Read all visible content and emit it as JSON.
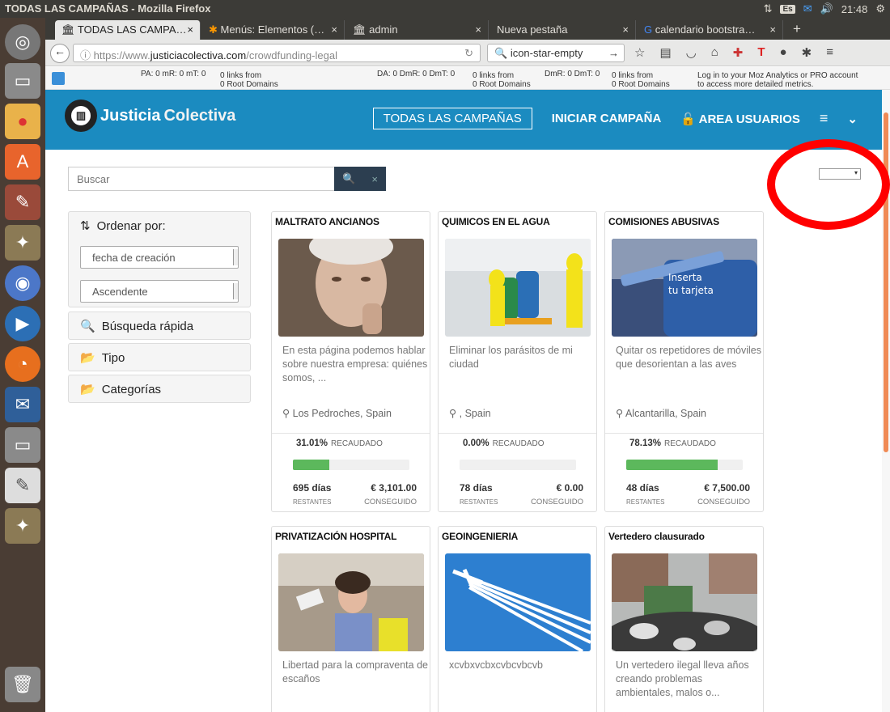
{
  "os": {
    "window_title": "TODAS LAS CAMPAÑAS - Mozilla Firefox",
    "kb": "Es",
    "clock": "21:48"
  },
  "browser": {
    "tabs": [
      {
        "label": "TODAS LAS CAMPA…"
      },
      {
        "label": "Menús: Elementos (…"
      },
      {
        "label": "admin"
      },
      {
        "label": "Nueva pestaña"
      },
      {
        "label": "calendario bootstra…"
      }
    ],
    "new_tab": "+",
    "url_prefix": "https://www.",
    "url_host": "justiciacolectiva.com",
    "url_path": "/crowdfunding-legal",
    "search_value": "icon-star-empty"
  },
  "moz": {
    "pa": "PA: 0   mR: 0   mT: 0",
    "links1a": "0 links from",
    "links1b": "0 Root Domains",
    "da": "DA: 0  DmR: 0  DmT: 0",
    "links2a": "0 links from",
    "links2b": "0 Root Domains",
    "dmr": "DmR: 0  DmT: 0",
    "links3a": "0 links from",
    "links3b": "0 Root Domains",
    "login_a": "Log in to your Moz Analytics or PRO account",
    "login_b": "to access more detailed metrics."
  },
  "site": {
    "logo_a": "Justicia",
    "logo_b": "Colectiva",
    "nav": {
      "all": "TODAS LAS CAMPAÑAS",
      "start": "INICIAR CAMPAÑA",
      "users": "AREA USUARIOS"
    }
  },
  "search": {
    "placeholder": "Buscar"
  },
  "filters": {
    "order_by": "Ordenar por:",
    "order_field": "fecha de creación",
    "order_dir": "Ascendente",
    "quick": "Búsqueda rápida",
    "type": "Tipo",
    "categories": "Categorías"
  },
  "cards": [
    {
      "title": "MALTRATO ANCIANOS",
      "desc": "En esta página podemos hablar sobre nuestra empresa: quiénes somos, ...",
      "location": "Los Pedroches, Spain",
      "percent": "31.01%",
      "raised_label": "RECAUDADO",
      "progress": 31.01,
      "days": "695 días",
      "days_label": "RESTANTES",
      "amount": "€ 3,101.00",
      "amount_label": "CONSEGUIDO"
    },
    {
      "title": "QUIMICOS EN EL AGUA",
      "desc": "Eliminar los parásitos de mi ciudad",
      "location": ", Spain",
      "percent": "0.00%",
      "raised_label": "RECAUDADO",
      "progress": 0,
      "days": "78 días",
      "days_label": "RESTANTES",
      "amount": "€ 0.00",
      "amount_label": "CONSEGUIDO"
    },
    {
      "title": "COMISIONES ABUSIVAS",
      "desc": "Quitar os repetidores de móviles que desorientan a las aves",
      "location": "Alcantarilla, Spain",
      "percent": "78.13%",
      "raised_label": "RECAUDADO",
      "progress": 78.13,
      "days": "48 días",
      "days_label": "RESTANTES",
      "amount": "€ 7,500.00",
      "amount_label": "CONSEGUIDO"
    },
    {
      "title": "PRIVATIZACIÓN HOSPITAL",
      "desc": "Libertad para la compraventa de escaños"
    },
    {
      "title": "GEOINGENIERIA",
      "desc": "xcvbxvcbxcvbcvbcvb"
    },
    {
      "title": "Vertedero clausurado",
      "desc": "Un vertedero ilegal lleva años creando problemas ambientales, malos o..."
    }
  ],
  "card_image_text": {
    "line1": "Inserta",
    "line2": "tu tarjeta"
  }
}
